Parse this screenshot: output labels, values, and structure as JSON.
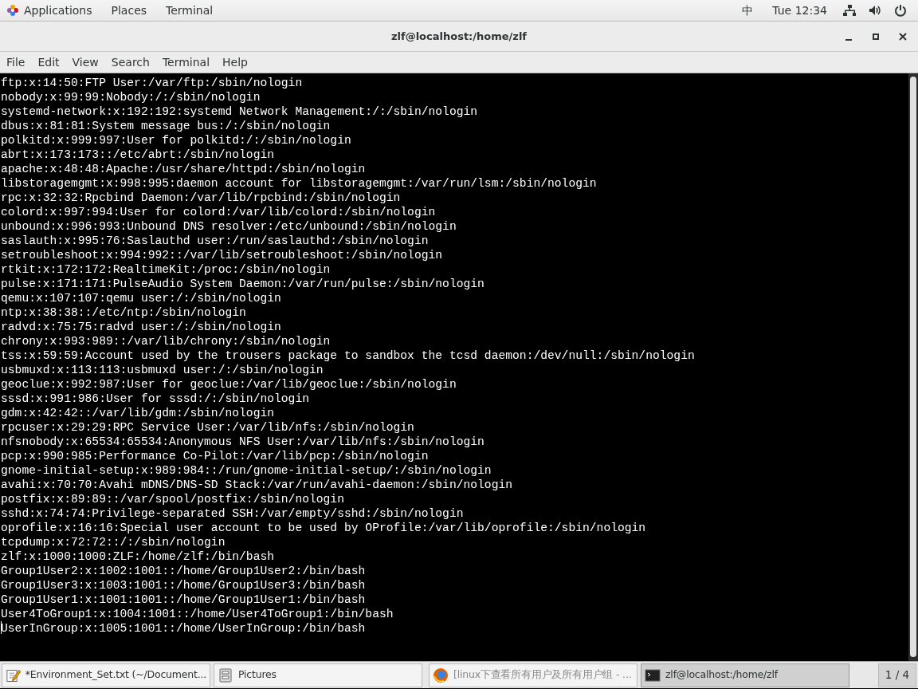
{
  "top_bar": {
    "menus": [
      "Applications",
      "Places",
      "Terminal"
    ],
    "input_method": "中",
    "clock": "Tue 12:34"
  },
  "window": {
    "title": "zlf@localhost:/home/zlf"
  },
  "menu_bar": [
    "File",
    "Edit",
    "View",
    "Search",
    "Terminal",
    "Help"
  ],
  "terminal": {
    "lines": [
      "ftp:x:14:50:FTP User:/var/ftp:/sbin/nologin",
      "nobody:x:99:99:Nobody:/:/sbin/nologin",
      "systemd-network:x:192:192:systemd Network Management:/:/sbin/nologin",
      "dbus:x:81:81:System message bus:/:/sbin/nologin",
      "polkitd:x:999:997:User for polkitd:/:/sbin/nologin",
      "abrt:x:173:173::/etc/abrt:/sbin/nologin",
      "apache:x:48:48:Apache:/usr/share/httpd:/sbin/nologin",
      "libstoragemgmt:x:998:995:daemon account for libstoragemgmt:/var/run/lsm:/sbin/nologin",
      "rpc:x:32:32:Rpcbind Daemon:/var/lib/rpcbind:/sbin/nologin",
      "colord:x:997:994:User for colord:/var/lib/colord:/sbin/nologin",
      "unbound:x:996:993:Unbound DNS resolver:/etc/unbound:/sbin/nologin",
      "saslauth:x:995:76:Saslauthd user:/run/saslauthd:/sbin/nologin",
      "setroubleshoot:x:994:992::/var/lib/setroubleshoot:/sbin/nologin",
      "rtkit:x:172:172:RealtimeKit:/proc:/sbin/nologin",
      "pulse:x:171:171:PulseAudio System Daemon:/var/run/pulse:/sbin/nologin",
      "qemu:x:107:107:qemu user:/:/sbin/nologin",
      "ntp:x:38:38::/etc/ntp:/sbin/nologin",
      "radvd:x:75:75:radvd user:/:/sbin/nologin",
      "chrony:x:993:989::/var/lib/chrony:/sbin/nologin",
      "tss:x:59:59:Account used by the trousers package to sandbox the tcsd daemon:/dev/null:/sbin/nologin",
      "usbmuxd:x:113:113:usbmuxd user:/:/sbin/nologin",
      "geoclue:x:992:987:User for geoclue:/var/lib/geoclue:/sbin/nologin",
      "sssd:x:991:986:User for sssd:/:/sbin/nologin",
      "gdm:x:42:42::/var/lib/gdm:/sbin/nologin",
      "rpcuser:x:29:29:RPC Service User:/var/lib/nfs:/sbin/nologin",
      "nfsnobody:x:65534:65534:Anonymous NFS User:/var/lib/nfs:/sbin/nologin",
      "pcp:x:990:985:Performance Co-Pilot:/var/lib/pcp:/sbin/nologin",
      "gnome-initial-setup:x:989:984::/run/gnome-initial-setup/:/sbin/nologin",
      "avahi:x:70:70:Avahi mDNS/DNS-SD Stack:/var/run/avahi-daemon:/sbin/nologin",
      "postfix:x:89:89::/var/spool/postfix:/sbin/nologin",
      "sshd:x:74:74:Privilege-separated SSH:/var/empty/sshd:/sbin/nologin",
      "oprofile:x:16:16:Special user account to be used by OProfile:/var/lib/oprofile:/sbin/nologin",
      "tcpdump:x:72:72::/:/sbin/nologin",
      "zlf:x:1000:1000:ZLF:/home/zlf:/bin/bash",
      "Group1User2:x:1002:1001::/home/Group1User2:/bin/bash",
      "Group1User3:x:1003:1001::/home/Group1User3:/bin/bash",
      "Group1User1:x:1001:1001::/home/Group1User1:/bin/bash",
      "User4ToGroup1:x:1004:1001::/home/User4ToGroup1:/bin/bash",
      "UserInGroup:x:1005:1001::/home/UserInGroup:/bin/bash"
    ]
  },
  "taskbar": {
    "items": [
      {
        "kind": "editor",
        "label": "*Environment_Set.txt (~/Document...",
        "selected": false
      },
      {
        "kind": "files",
        "label": "Pictures",
        "selected": false
      },
      {
        "kind": "browser",
        "label": "[linux下查看所有用户及所有用户组 - ...",
        "selected": false
      },
      {
        "kind": "terminal",
        "label": "zlf@localhost:/home/zlf",
        "selected": true
      }
    ],
    "workspace": "1 / 4"
  }
}
